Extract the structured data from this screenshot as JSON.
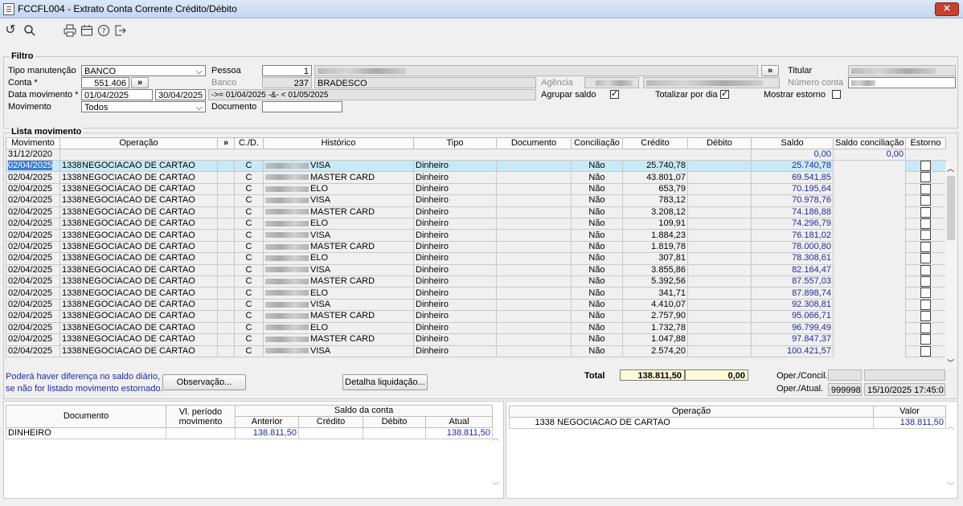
{
  "window": {
    "title": "FCCFL004 - Extrato Conta Corrente Crédito/Débito",
    "close": "✕"
  },
  "toolbar": {
    "icons": [
      "undo-icon",
      "search-icon",
      "print-icon",
      "calendar-icon",
      "help-icon",
      "exit-icon"
    ]
  },
  "filtro": {
    "title": "Filtro",
    "tipo_manutencao_label": "Tipo manutenção",
    "tipo_manutencao_value": "BANCO",
    "conta_label": "Conta *",
    "conta_value": "551.406",
    "arrow": "»",
    "data_mov_label": "Data movimento *",
    "data_ini": "01/04/2025",
    "data_fim": "30/04/2025",
    "data_expr": "->= 01/04/2025 -&- < 01/05/2025",
    "movimento_label": "Movimento",
    "movimento_value": "Todos",
    "pessoa_label": "Pessoa",
    "pessoa_value": "1",
    "banco_label": "Banco",
    "banco_code": "237",
    "banco_name": "BRADESCO",
    "documento_label": "Documento",
    "documento_value": "",
    "agencia_label": "Agência",
    "titular_label": "Titular",
    "numero_conta_label": "Número conta",
    "agrupar_label": "Agrupar saldo",
    "agrupar_checked": true,
    "totalizar_label": "Totalizar por dia",
    "totalizar_checked": true,
    "estorno_label": "Mostrar estorno",
    "estorno_checked": false
  },
  "lista": {
    "title": "Lista movimento",
    "headers": [
      "Movimento",
      "Operação",
      "»",
      "C./D.",
      "Histórico",
      "Tipo",
      "Documento",
      "Conciliação",
      "Crédito",
      "Débito",
      "Saldo",
      "Saldo conciliação",
      "Estorno"
    ],
    "opening": {
      "date": "31/12/2020",
      "saldo": "0,00",
      "saldo_conc": "0,00"
    },
    "rows": [
      {
        "date": "02/04/2025",
        "op": "1338",
        "op_name": "NEGOCIACAO DE CARTAO",
        "cd": "C",
        "hist": "VISA",
        "tipo": "Dinheiro",
        "conc": "Não",
        "credito": "25.740,78",
        "saldo": "25.740,78"
      },
      {
        "date": "02/04/2025",
        "op": "1338",
        "op_name": "NEGOCIACAO DE CARTAO",
        "cd": "C",
        "hist": "MASTER CARD",
        "tipo": "Dinheiro",
        "conc": "Não",
        "credito": "43.801,07",
        "saldo": "69.541,85"
      },
      {
        "date": "02/04/2025",
        "op": "1338",
        "op_name": "NEGOCIACAO DE CARTAO",
        "cd": "C",
        "hist": "ELO",
        "tipo": "Dinheiro",
        "conc": "Não",
        "credito": "653,79",
        "saldo": "70.195,64"
      },
      {
        "date": "02/04/2025",
        "op": "1338",
        "op_name": "NEGOCIACAO DE CARTAO",
        "cd": "C",
        "hist": "VISA",
        "tipo": "Dinheiro",
        "conc": "Não",
        "credito": "783,12",
        "saldo": "70.978,76"
      },
      {
        "date": "02/04/2025",
        "op": "1338",
        "op_name": "NEGOCIACAO DE CARTAO",
        "cd": "C",
        "hist": "MASTER CARD",
        "tipo": "Dinheiro",
        "conc": "Não",
        "credito": "3.208,12",
        "saldo": "74.186,88"
      },
      {
        "date": "02/04/2025",
        "op": "1338",
        "op_name": "NEGOCIACAO DE CARTAO",
        "cd": "C",
        "hist": "ELO",
        "tipo": "Dinheiro",
        "conc": "Não",
        "credito": "109,91",
        "saldo": "74.296,79"
      },
      {
        "date": "02/04/2025",
        "op": "1338",
        "op_name": "NEGOCIACAO DE CARTAO",
        "cd": "C",
        "hist": "VISA",
        "tipo": "Dinheiro",
        "conc": "Não",
        "credito": "1.884,23",
        "saldo": "76.181,02"
      },
      {
        "date": "02/04/2025",
        "op": "1338",
        "op_name": "NEGOCIACAO DE CARTAO",
        "cd": "C",
        "hist": "MASTER CARD",
        "tipo": "Dinheiro",
        "conc": "Não",
        "credito": "1.819,78",
        "saldo": "78.000,80"
      },
      {
        "date": "02/04/2025",
        "op": "1338",
        "op_name": "NEGOCIACAO DE CARTAO",
        "cd": "C",
        "hist": "ELO",
        "tipo": "Dinheiro",
        "conc": "Não",
        "credito": "307,81",
        "saldo": "78.308,61"
      },
      {
        "date": "02/04/2025",
        "op": "1338",
        "op_name": "NEGOCIACAO DE CARTAO",
        "cd": "C",
        "hist": "VISA",
        "tipo": "Dinheiro",
        "conc": "Não",
        "credito": "3.855,86",
        "saldo": "82.164,47"
      },
      {
        "date": "02/04/2025",
        "op": "1338",
        "op_name": "NEGOCIACAO DE CARTAO",
        "cd": "C",
        "hist": "MASTER CARD",
        "tipo": "Dinheiro",
        "conc": "Não",
        "credito": "5.392,56",
        "saldo": "87.557,03"
      },
      {
        "date": "02/04/2025",
        "op": "1338",
        "op_name": "NEGOCIACAO DE CARTAO",
        "cd": "C",
        "hist": "ELO",
        "tipo": "Dinheiro",
        "conc": "Não",
        "credito": "341,71",
        "saldo": "87.898,74"
      },
      {
        "date": "02/04/2025",
        "op": "1338",
        "op_name": "NEGOCIACAO DE CARTAO",
        "cd": "C",
        "hist": "VISA",
        "tipo": "Dinheiro",
        "conc": "Não",
        "credito": "4.410,07",
        "saldo": "92.308,81"
      },
      {
        "date": "02/04/2025",
        "op": "1338",
        "op_name": "NEGOCIACAO DE CARTAO",
        "cd": "C",
        "hist": "MASTER CARD",
        "tipo": "Dinheiro",
        "conc": "Não",
        "credito": "2.757,90",
        "saldo": "95.066,71"
      },
      {
        "date": "02/04/2025",
        "op": "1338",
        "op_name": "NEGOCIACAO DE CARTAO",
        "cd": "C",
        "hist": "ELO",
        "tipo": "Dinheiro",
        "conc": "Não",
        "credito": "1.732,78",
        "saldo": "96.799,49"
      },
      {
        "date": "02/04/2025",
        "op": "1338",
        "op_name": "NEGOCIACAO DE CARTAO",
        "cd": "C",
        "hist": "MASTER CARD",
        "tipo": "Dinheiro",
        "conc": "Não",
        "credito": "1.047,88",
        "saldo": "97.847,37"
      },
      {
        "date": "02/04/2025",
        "op": "1338",
        "op_name": "NEGOCIACAO DE CARTAO",
        "cd": "C",
        "hist": "VISA",
        "tipo": "Dinheiro",
        "conc": "Não",
        "credito": "2.574,20",
        "saldo": "100.421,57"
      }
    ],
    "note_line1": "Poderá haver diferença no saldo diário,",
    "note_line2": "se não for listado movimento estornado.",
    "btn_observacao": "Observação...",
    "btn_detalha": "Detalha liquidação...",
    "total_label": "Total",
    "total_credito": "138.811,50",
    "total_debito": "0,00",
    "oper_concil_label": "Oper./Concil.",
    "oper_atual_label": "Oper./Atual.",
    "oper_atual_code": "999998",
    "oper_atual_ts": "15/10/2025 17:45:07"
  },
  "resumo": {
    "h_documento": "Documento",
    "h_vl_periodo_1": "Vl. período",
    "h_vl_periodo_2": "movimento",
    "h_saldo_conta": "Saldo da conta",
    "h_anterior": "Anterior",
    "h_credito": "Crédito",
    "h_debito": "Débito",
    "h_atual": "Atual",
    "row": {
      "documento": "DINHEIRO",
      "anterior": "138.811,50",
      "atual": "138.811,50"
    }
  },
  "operacao_panel": {
    "h_operacao": "Operação",
    "h_valor": "Valor",
    "row": {
      "code": "1338",
      "name": "NEGOCIACAO DE CARTAO",
      "valor": "138.811,50"
    }
  }
}
